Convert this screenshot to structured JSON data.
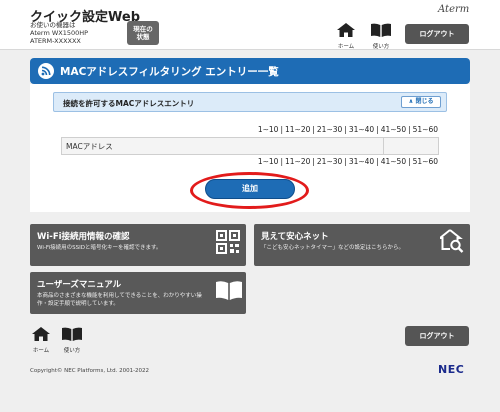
{
  "header": {
    "title": "クイック設定Web",
    "device_line1": "お使いの機器は",
    "device_line2": "Aterm WX1500HP",
    "device_line3": "ATERM-XXXXXX",
    "status_line1": "現在の",
    "status_line2": "状態",
    "brand": "Aterm",
    "home_label": "ホーム",
    "manual_label": "使い方",
    "logout_label": "ログアウト"
  },
  "main": {
    "banner_title": "MACアドレスフィルタリング エントリー一覧",
    "section_title": "接続を許可するMACアドレスエントリ",
    "collapse_label": "閉じる",
    "pager": [
      "1∼10",
      "11∼20",
      "21∼30",
      "31∼40",
      "41∼50",
      "51∼60"
    ],
    "table_header": "MACアドレス",
    "add_label": "追加"
  },
  "cards": {
    "wifi": {
      "title": "Wi-Fi接続用情報の確認",
      "desc": "Wi-Fi接続用のSSIDと暗号化キーを確認できます。"
    },
    "safety": {
      "title": "見えて安心ネット",
      "desc": "「こども安心ネットタイマー」などの設定はこちらから。"
    },
    "manual": {
      "title": "ユーザーズマニュアル",
      "desc1": "本商品のさまざまな機能を利用してできることを、わかりやすい操",
      "desc2": "作・設定手順で説明しています。"
    }
  },
  "footer": {
    "home_label": "ホーム",
    "manual_label": "使い方",
    "logout_label": "ログアウト",
    "copyright": "Copyright© NEC Platforms, Ltd. 2001-2022",
    "nec": "NEC"
  },
  "colors": {
    "accent": "#1e6cb5",
    "highlight_ring": "#e21b1b",
    "card_bg": "#595959"
  }
}
